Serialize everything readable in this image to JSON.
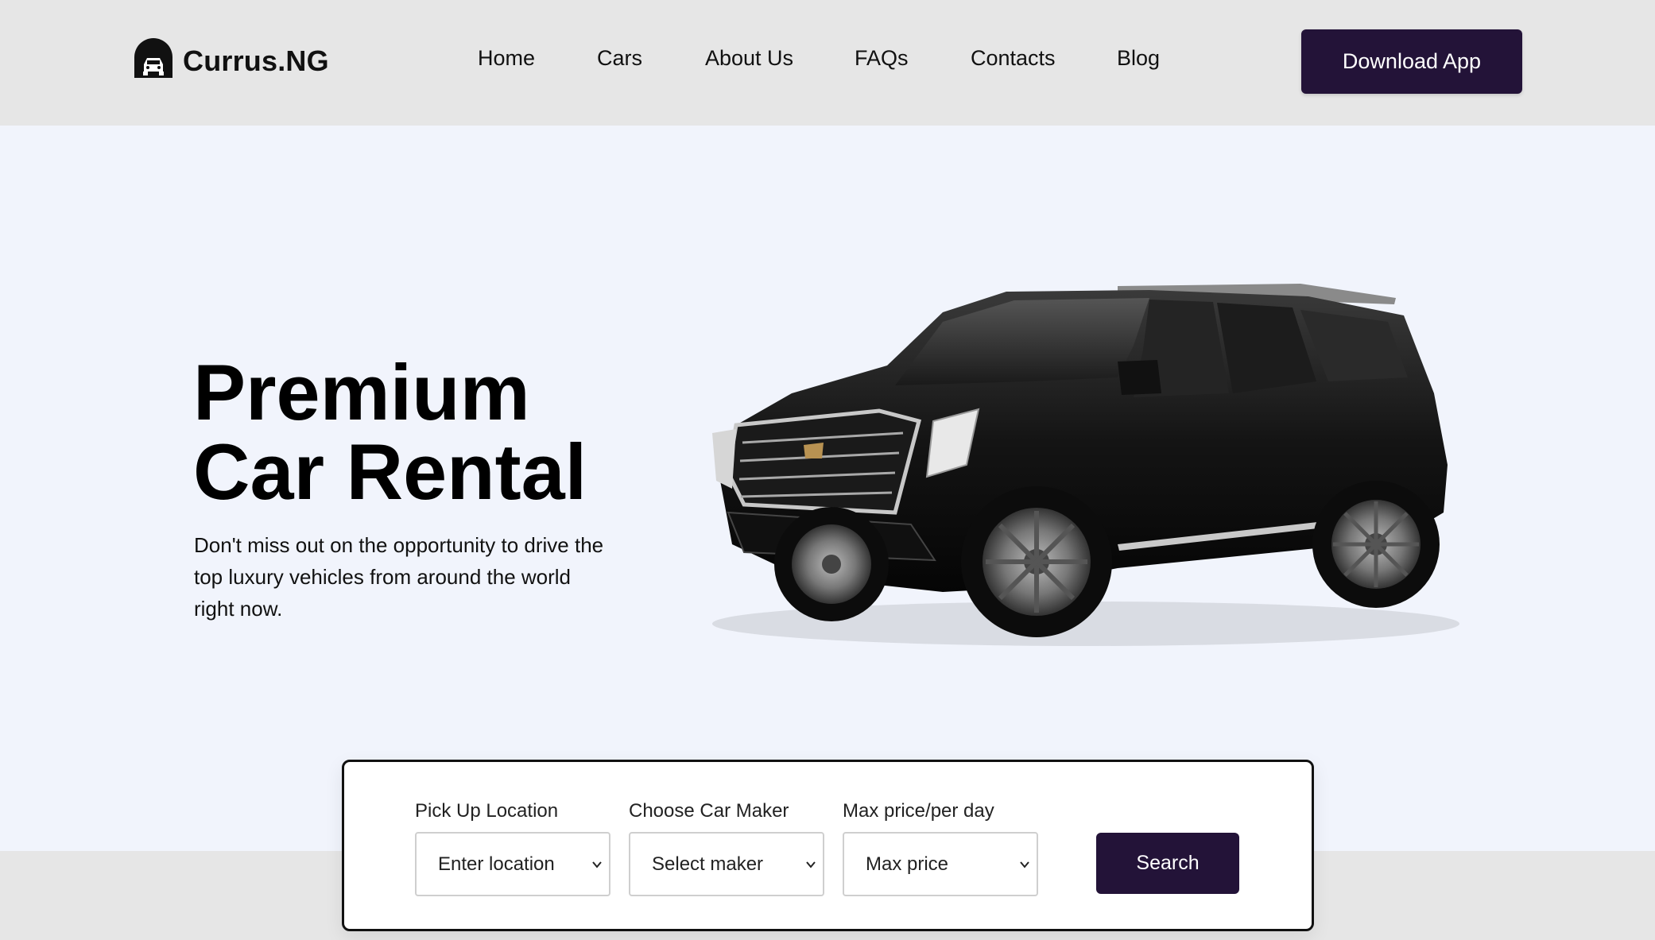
{
  "brand": {
    "name": "Currus.NG",
    "icon": "car-garage-icon"
  },
  "nav": {
    "items": [
      {
        "label": "Home"
      },
      {
        "label": "Cars"
      },
      {
        "label": "About Us"
      },
      {
        "label": "FAQs"
      },
      {
        "label": "Contacts"
      },
      {
        "label": "Blog"
      }
    ],
    "download_label": "Download App"
  },
  "hero": {
    "title_line1": "Premium",
    "title_line2": "Car Rental",
    "description": "Don't miss out on the opportunity to drive the top luxury vehicles from around the world right now.",
    "image": "black-luxury-suv"
  },
  "search": {
    "location": {
      "label": "Pick Up Location",
      "value": "Enter location"
    },
    "maker": {
      "label": "Choose Car Maker",
      "value": "Select maker"
    },
    "price": {
      "label": "Max price/per day",
      "value": "Max price"
    },
    "button_label": "Search",
    "chevron_icon": "chevron-down-icon"
  },
  "colors": {
    "accent": "#231338",
    "header_bg": "#e6e6e6",
    "hero_bg": "#f1f4fc"
  }
}
